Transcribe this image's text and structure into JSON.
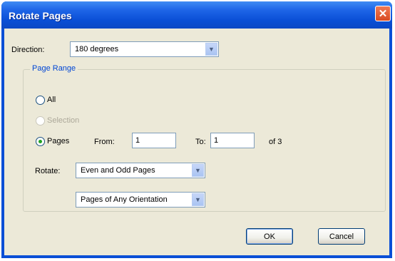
{
  "dialog": {
    "title": "Rotate Pages",
    "close_glyph": "✕"
  },
  "direction": {
    "label": "Direction:",
    "value": "180 degrees"
  },
  "page_range": {
    "legend": "Page Range",
    "all_label": "All",
    "selection_label": "Selection",
    "pages_label": "Pages",
    "selected": "pages",
    "from_label": "From:",
    "from_value": "1",
    "to_label": "To:",
    "to_value": "1",
    "of_text": "of 3"
  },
  "rotate": {
    "label": "Rotate:",
    "parity_value": "Even and Odd Pages",
    "orientation_value": "Pages of Any Orientation"
  },
  "buttons": {
    "ok": "OK",
    "cancel": "Cancel"
  },
  "icons": {
    "dropdown": "chevron-down-icon",
    "close": "close-icon"
  },
  "colors": {
    "titlebar": "#0a4fd6",
    "client_bg": "#ece9d8",
    "legend_text": "#0046d5",
    "close_button": "#d84a22"
  }
}
